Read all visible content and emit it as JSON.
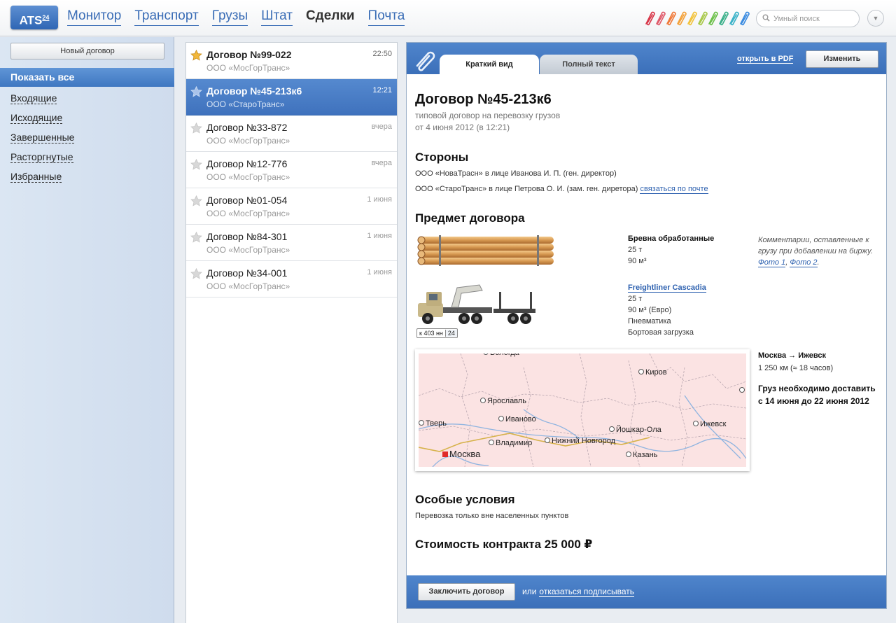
{
  "header": {
    "logo": "ATS",
    "logo_sup": "24",
    "nav": [
      "Монитор",
      "Транспорт",
      "Грузы",
      "Штат",
      "Сделки",
      "Почта"
    ],
    "active_nav": "Сделки",
    "search_placeholder": "Умный поиск",
    "clip_colors": [
      "#d8384a",
      "#e05a6a",
      "#f07a3a",
      "#f3a23b",
      "#f2c33c",
      "#a8c84a",
      "#6cc04a",
      "#3bb08a",
      "#3ab2c8",
      "#3a8be0"
    ]
  },
  "sidebar": {
    "new_contract": "Новый договор",
    "show_all": "Показать все",
    "items": [
      "Входящие",
      "Исходящие",
      "Завершенные",
      "Расторгнутые",
      "Избранные"
    ]
  },
  "contracts": [
    {
      "title": "Договор №99-022",
      "company": "ООО «МосГорТранс»",
      "time": "22:50",
      "starred": true,
      "unread": true,
      "selected": false
    },
    {
      "title": "Договор №45-213к6",
      "company": "ООО «СтароТранс»",
      "time": "12:21",
      "starred": true,
      "unread": true,
      "selected": true
    },
    {
      "title": "Договор №33-872",
      "company": "ООО «МосГорТранс»",
      "time": "вчера",
      "starred": false,
      "unread": false,
      "selected": false
    },
    {
      "title": "Договор №12-776",
      "company": "ООО «МосГорТранс»",
      "time": "вчера",
      "starred": false,
      "unread": false,
      "selected": false
    },
    {
      "title": "Договор №01-054",
      "company": "ООО «МосГорТранс»",
      "time": "1 июня",
      "starred": false,
      "unread": false,
      "selected": false
    },
    {
      "title": "Договор №84-301",
      "company": "ООО «МосГорТранс»",
      "time": "1 июня",
      "starred": false,
      "unread": false,
      "selected": false
    },
    {
      "title": "Договор №34-001",
      "company": "ООО «МосГорТранс»",
      "time": "1 июня",
      "starred": false,
      "unread": false,
      "selected": false
    }
  ],
  "detail": {
    "tab_short": "Краткий вид",
    "tab_full": "Полный текст",
    "pdf_link": "открыть в PDF",
    "edit_button": "Изменить",
    "title": "Договор №45-213к6",
    "subtitle": "типовой договор на перевозку грузов",
    "date": "от 4 июня 2012 (в 12:21)",
    "parties_heading": "Стороны",
    "party1": "ООО «НоваТрасн» в лице Иванова И. П. (ген. директор)",
    "party2": "ООО «СтароТранс» в лице Петрова О. И. (зам. ген. диретора)",
    "contact_link": "связаться по почте",
    "subject_heading": "Предмет договора",
    "cargo": {
      "name": "Бревна обработанные",
      "weight": "25 т",
      "volume": "90 м³"
    },
    "comment_text": "Комментарии, оставленные к грузу при добавлении на биржу.",
    "photo1": "Фото 1",
    "photo2": "Фото 2",
    "truck": {
      "name": "Freightliner Cascadia",
      "weight": "25 т",
      "volume": "90 м³ (Евро)",
      "suspension": "Пневматика",
      "loading": "Бортовая загрузка"
    },
    "plate_number": "к 403 нн",
    "plate_region": "24",
    "map_cities": [
      "Вологда",
      "Киров",
      "Ярославль",
      "Тверь",
      "Иваново",
      "Йошкар-Ола",
      "Ижевск",
      "Владимир",
      "Нижний Новгород",
      "Москва",
      "Казань"
    ],
    "route": "Москва → Ижевск",
    "distance": "1 250 км (≈ 18 часов)",
    "delivery_line1": "Груз необходимо доставить",
    "delivery_line2": "с 14 июня до 22 июня 2012",
    "special_heading": "Особые условия",
    "special_text": "Перевозка только вне населенных пунктов",
    "cost": "Стоимость контракта 25 000 ₽",
    "sign_button": "Заключить договор",
    "or_text": "или",
    "decline_link": "отказаться подписывать"
  }
}
